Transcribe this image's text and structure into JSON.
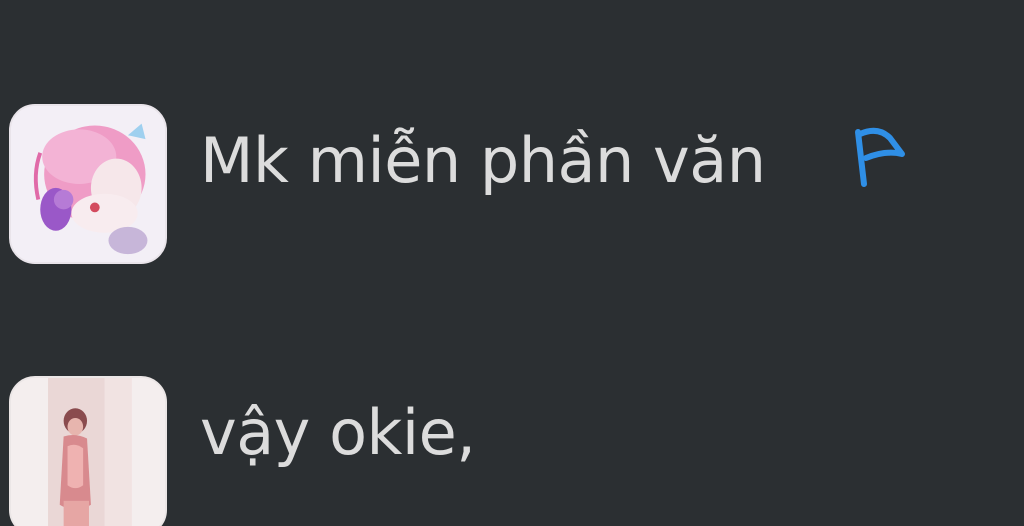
{
  "messages": [
    {
      "avatar_icon": "user-avatar-icon",
      "text": "Mk miễn phần văn",
      "flag_icon": "flag-icon",
      "flag_color": "#2f8fe6"
    },
    {
      "avatar_icon": "user-avatar-icon",
      "text": "vậy okie,"
    }
  ],
  "colors": {
    "background": "#2b2f32",
    "text": "#dcdcdc",
    "accent": "#2f8fe6"
  }
}
